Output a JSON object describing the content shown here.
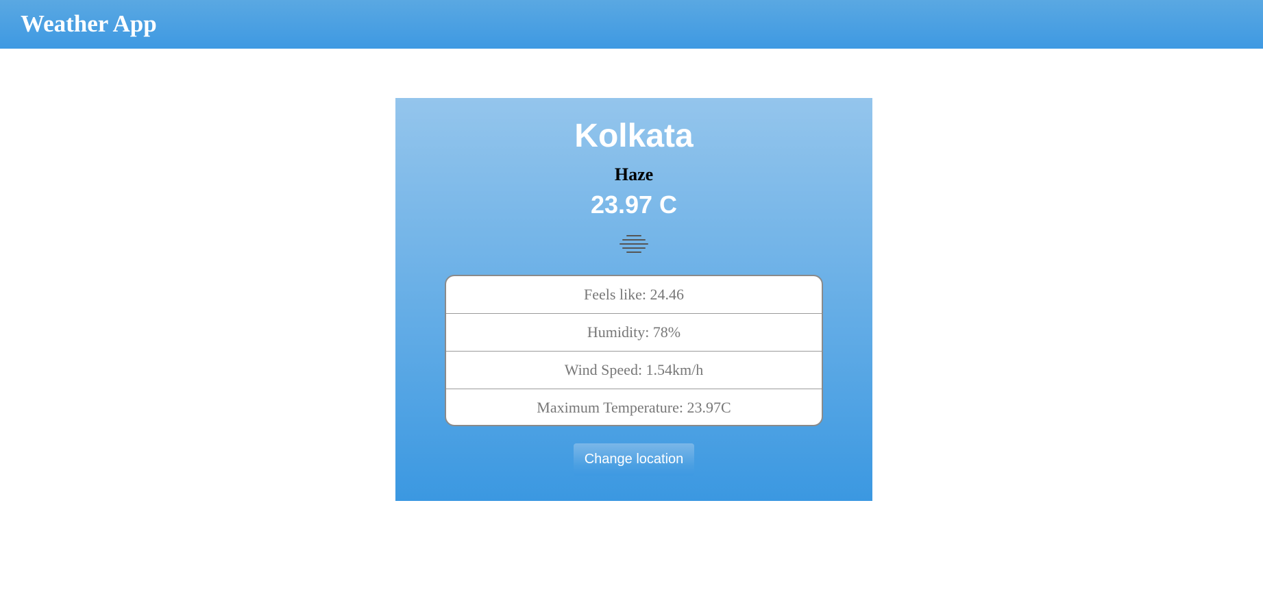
{
  "header": {
    "title": "Weather App",
    "background_color": "#3e99e2"
  },
  "weather": {
    "city": "Kolkata",
    "condition": "Haze",
    "temperature": "23.97 C",
    "icon": "haze-icon"
  },
  "details": [
    {
      "label": "Feels like: 24.46"
    },
    {
      "label": "Humidity: 78%"
    },
    {
      "label": "Wind Speed: 1.54km/h"
    },
    {
      "label": "Maximum Temperature: 23.97C"
    }
  ],
  "actions": {
    "change_location_label": "Change location"
  },
  "colors": {
    "card_top": "#94c5ec",
    "card_bottom": "#3b98e1",
    "detail_text": "#777777"
  }
}
